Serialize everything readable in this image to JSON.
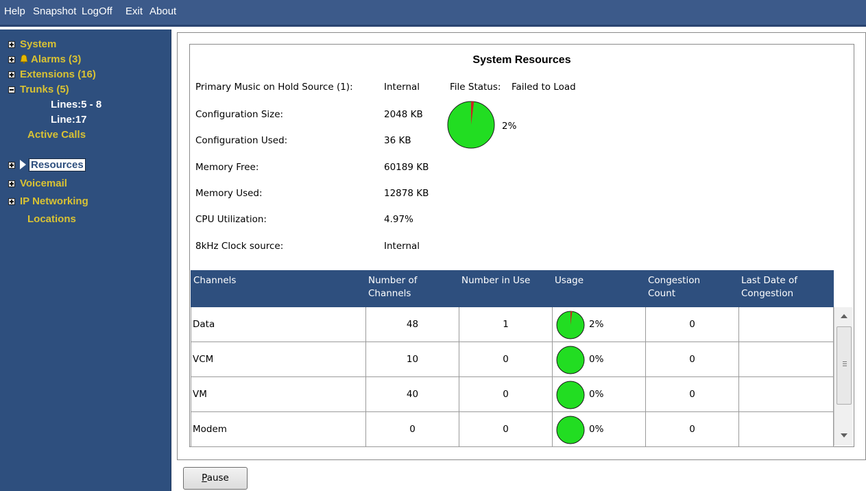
{
  "menu": [
    "Help",
    "Snapshot",
    "LogOff",
    "Exit",
    "About"
  ],
  "tree": {
    "system": "System",
    "alarms": "Alarms (3)",
    "extensions": "Extensions (16)",
    "trunks": "Trunks (5)",
    "trunk_lines_1": "Lines:5 - 8",
    "trunk_lines_2": "Line:17",
    "active_calls": "Active Calls",
    "resources": "Resources",
    "voicemail": "Voicemail",
    "ip_networking": "IP Networking",
    "locations": "Locations"
  },
  "resources": {
    "title": "System Resources",
    "moh_label": "Primary Music on Hold Source (1):",
    "moh_value": "Internal",
    "file_status_label": "File Status:",
    "file_status_value": "Failed to Load",
    "config_size_label": "Configuration Size:",
    "config_size_value": "2048 KB",
    "config_used_label": "Configuration Used:",
    "config_used_value": "36 KB",
    "config_used_pct": "2%",
    "config_used_fraction": 0.02,
    "mem_free_label": "Memory Free:",
    "mem_free_value": "60189 KB",
    "mem_used_label": "Memory Used:",
    "mem_used_value": "12878 KB",
    "cpu_label": "CPU Utilization:",
    "cpu_value": "4.97%",
    "clock_label": "8kHz Clock source:",
    "clock_value": "Internal"
  },
  "table": {
    "headers": {
      "channels": "Channels",
      "num_channels_1": "Number of",
      "num_channels_2": "Channels",
      "num_in_use": "Number in Use",
      "usage": "Usage",
      "congestion_1": "Congestion",
      "congestion_2": "Count",
      "last_date_1": "Last Date of",
      "last_date_2": "Congestion"
    },
    "rows": [
      {
        "channel": "Data",
        "number": "48",
        "in_use": "1",
        "usage": "2%",
        "usage_fraction": 0.02,
        "congestion": "0",
        "last_date": ""
      },
      {
        "channel": "VCM",
        "number": "10",
        "in_use": "0",
        "usage": "0%",
        "usage_fraction": 0,
        "congestion": "0",
        "last_date": ""
      },
      {
        "channel": "VM",
        "number": "40",
        "in_use": "0",
        "usage": "0%",
        "usage_fraction": 0,
        "congestion": "0",
        "last_date": ""
      },
      {
        "channel": "Modem",
        "number": "0",
        "in_use": "0",
        "usage": "0%",
        "usage_fraction": 0,
        "congestion": "0",
        "last_date": ""
      }
    ]
  },
  "buttons": {
    "pause_label": "Pause",
    "pause_mnemonic": "P",
    "pause_rest": "ause"
  },
  "colors": {
    "pie_free": "#22dd22",
    "pie_used": "#cc2222",
    "header_bg": "#2e4f7e",
    "tree_text": "#d9c233"
  }
}
